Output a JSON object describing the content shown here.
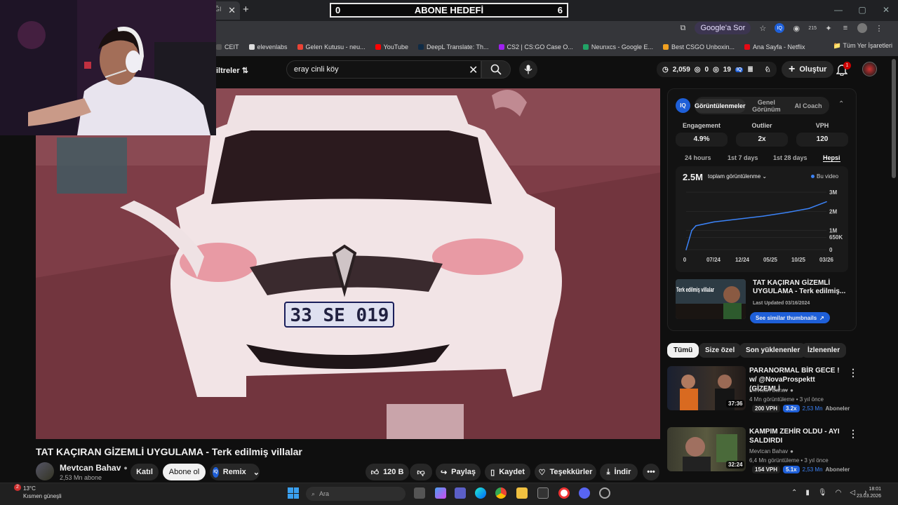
{
  "browser": {
    "tab_partial": "ĞI",
    "close_tab": "✕",
    "new_tab": "+",
    "ask_label": "Google'a Sor",
    "ext_badge": "215",
    "bookmarks": [
      {
        "label": "CEIT",
        "color": "#555"
      },
      {
        "label": "elevenlabs",
        "color": "#ddd"
      },
      {
        "label": "Gelen Kutusu - neu...",
        "color": "#ea4335"
      },
      {
        "label": "YouTube",
        "color": "#ff0000"
      },
      {
        "label": "DeepL Translate: Th...",
        "color": "#0f2b46"
      },
      {
        "label": "CS2 | CS:GO Case O...",
        "color": "#a020f0"
      },
      {
        "label": "Neunxcs - Google E...",
        "color": "#21a366"
      },
      {
        "label": "Best CSGO Unboxin...",
        "color": "#f0a020"
      },
      {
        "label": "Ana Sayfa - Netflix",
        "color": "#e50914"
      }
    ],
    "all_bookmarks": "Tüm Yer İşaretleri"
  },
  "overlay": {
    "left": "0",
    "title": "ABONE HEDEFİ",
    "right": "6"
  },
  "header": {
    "filters": "iltreler",
    "search_value": "eray cinli köy",
    "stats": {
      "a": "2,059",
      "b": "0",
      "c": "19"
    },
    "create": "Oluştur",
    "notif_count": "1"
  },
  "video": {
    "title": "TAT KAÇIRAN GİZEMLİ UYGULAMA - Terk edilmiş villalar",
    "plate": "33 SE 019",
    "channel": "Mevtcan Bahav",
    "subs": "2,53 Mn abone",
    "join": "Katıl",
    "subscribe": "Abone ol",
    "remix": "Remix",
    "likes": "120 B",
    "share": "Paylaş",
    "save": "Kaydet",
    "thanks": "Teşekkürler",
    "download": "İndir"
  },
  "panel": {
    "logo": "IQ",
    "tabs": [
      "Görüntülenmeler",
      "Genel Görünüm",
      "AI Coach"
    ],
    "metrics": [
      {
        "label": "Engagement",
        "value": "4.9%"
      },
      {
        "label": "Outlier",
        "value": "2x"
      },
      {
        "label": "VPH",
        "value": "120"
      }
    ],
    "ranges": [
      "24 hours",
      "1st 7 days",
      "1st 28 days",
      "Hepsi"
    ],
    "views_total": "2.5M",
    "views_dropdown": "toplam görüntülenme",
    "legend": "Bu video",
    "thumb_title": "TAT KAÇIRAN GİZEMLİ UYGULAMA - Terk edilmiş...",
    "thumb_text": "Terk edilmiş villalar",
    "last_updated": "Last Updated 03/16/2024",
    "see_similar": "See similar thumbnails"
  },
  "chart_data": {
    "type": "line",
    "x": [
      "0",
      "07/24",
      "12/24",
      "05/25",
      "10/25",
      "03/26"
    ],
    "y_ticks": [
      "3M",
      "2M",
      "1M",
      "650K",
      "0"
    ],
    "series": [
      {
        "name": "Bu video",
        "values": [
          0,
          1.0,
          1.25,
          1.45,
          1.6,
          1.75,
          1.95,
          2.15,
          2.5
        ]
      }
    ],
    "ylim": [
      0,
      3
    ],
    "grid": true,
    "legend": "top-right",
    "color": "#3b82f6"
  },
  "chips": [
    "Tümü",
    "Size özel",
    "Son yüklenenler",
    "İzlenenler"
  ],
  "related": [
    {
      "title": "PARANORMAL BİR GECE ! w/ @NovaProspektt (GİZEMLİ ...",
      "channel": "Mevtcan Bahav",
      "meta": "4 Mn görüntüleme • 3 yıl önce",
      "vph": "200 VPH",
      "mult": "3.2x",
      "subs": "2,53 Mn",
      "subs_label": "Aboneler",
      "duration": "37:36"
    },
    {
      "title": "KAMPIM ZEHİR OLDU - AYI SALDIRDI",
      "channel": "Mevtcan Bahav",
      "meta": "6,4 Mn görüntüleme • 3 yıl önce",
      "vph": "154 VPH",
      "mult": "5.1x",
      "subs": "2,53 Mn",
      "subs_label": "Aboneler",
      "duration": "32:24"
    }
  ],
  "taskbar": {
    "temp": "13°C",
    "weather": "Kısmen güneşli",
    "weather_badge": "2",
    "search": "Ara",
    "time": "18:01",
    "date": "23.03.2026"
  }
}
